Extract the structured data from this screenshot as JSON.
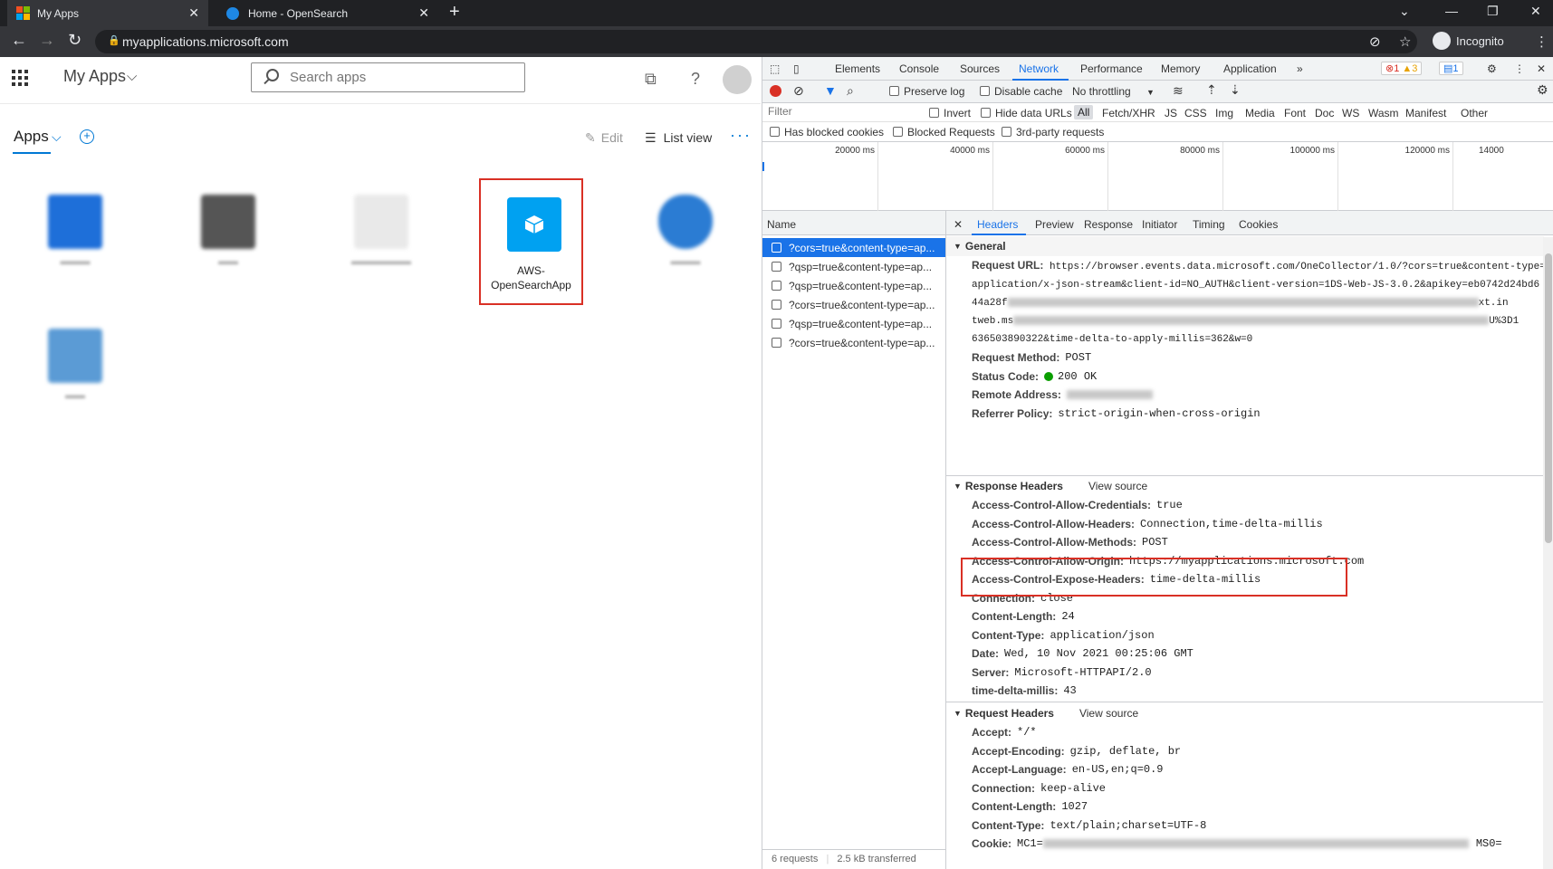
{
  "browser": {
    "tabs": [
      {
        "title": "My Apps",
        "active": true
      },
      {
        "title": "Home - OpenSearch",
        "active": false
      }
    ],
    "url": "myapplications.microsoft.com",
    "profile": "Incognito"
  },
  "myapps": {
    "app_title": "My Apps",
    "search_placeholder": "Search apps",
    "section_title": "Apps",
    "edit_label": "Edit",
    "list_view_label": "List view",
    "highlighted_app": {
      "line1": "AWS-",
      "line2": "OpenSearchApp"
    }
  },
  "devtools": {
    "tabs": [
      "Elements",
      "Console",
      "Sources",
      "Network",
      "Performance",
      "Memory",
      "Application"
    ],
    "active_tab": "Network",
    "error_count": "1",
    "warning_count": "3",
    "info_count": "1",
    "toolbar": {
      "preserve_log": "Preserve log",
      "disable_cache": "Disable cache",
      "throttling": "No throttling"
    },
    "filter": {
      "placeholder": "Filter",
      "invert": "Invert",
      "hide_data_urls": "Hide data URLs",
      "types": [
        "All",
        "Fetch/XHR",
        "JS",
        "CSS",
        "Img",
        "Media",
        "Font",
        "Doc",
        "WS",
        "Wasm",
        "Manifest",
        "Other"
      ],
      "has_blocked_cookies": "Has blocked cookies",
      "blocked_requests": "Blocked Requests",
      "third_party": "3rd-party requests"
    },
    "timeline_labels": [
      "20000 ms",
      "40000 ms",
      "60000 ms",
      "80000 ms",
      "100000 ms",
      "120000 ms",
      "14000"
    ],
    "request_list": {
      "column_name": "Name",
      "rows": [
        "?cors=true&content-type=ap...",
        "?qsp=true&content-type=ap...",
        "?qsp=true&content-type=ap...",
        "?cors=true&content-type=ap...",
        "?qsp=true&content-type=ap...",
        "?cors=true&content-type=ap..."
      ],
      "footer_requests": "6 requests",
      "footer_transferred": "2.5 kB transferred"
    },
    "detail_tabs": [
      "Headers",
      "Preview",
      "Response",
      "Initiator",
      "Timing",
      "Cookies"
    ],
    "general": {
      "title": "General",
      "request_url_label": "Request URL:",
      "request_url_1": "https://browser.events.data.microsoft.com/OneCollector/1.0/?cors=true&content-type=",
      "request_url_2": "application/x-json-stream&client-id=NO_AUTH&client-version=1DS-Web-JS-3.0.2&apikey=eb0742d24bd6",
      "request_url_3_start": "44a28f",
      "request_url_3_end": "xt.in",
      "request_url_4_start": "tweb.ms",
      "request_url_4_end": "U%3D1",
      "request_url_5": "636503890322&time-delta-to-apply-millis=362&w=0",
      "method_label": "Request Method:",
      "method": "POST",
      "status_label": "Status Code:",
      "status": "200 OK",
      "remote_label": "Remote Address:",
      "referrer_label": "Referrer Policy:",
      "referrer": "strict-origin-when-cross-origin"
    },
    "response_headers": {
      "title": "Response Headers",
      "view_source": "View source",
      "items": [
        {
          "k": "Access-Control-Allow-Credentials:",
          "v": "true"
        },
        {
          "k": "Access-Control-Allow-Headers:",
          "v": "Connection,time-delta-millis"
        },
        {
          "k": "Access-Control-Allow-Methods:",
          "v": "POST"
        },
        {
          "k": "Access-Control-Allow-Origin:",
          "v": "https://myapplications.microsoft.com"
        },
        {
          "k": "Access-Control-Expose-Headers:",
          "v": "time-delta-millis"
        },
        {
          "k": "Connection:",
          "v": "close"
        },
        {
          "k": "Content-Length:",
          "v": "24"
        },
        {
          "k": "Content-Type:",
          "v": "application/json"
        },
        {
          "k": "Date:",
          "v": "Wed, 10 Nov 2021 00:25:06 GMT"
        },
        {
          "k": "Server:",
          "v": "Microsoft-HTTPAPI/2.0"
        },
        {
          "k": "time-delta-millis:",
          "v": "43"
        }
      ]
    },
    "request_headers": {
      "title": "Request Headers",
      "view_source": "View source",
      "items": [
        {
          "k": "Accept:",
          "v": "*/*"
        },
        {
          "k": "Accept-Encoding:",
          "v": "gzip, deflate, br"
        },
        {
          "k": "Accept-Language:",
          "v": "en-US,en;q=0.9"
        },
        {
          "k": "Connection:",
          "v": "keep-alive"
        },
        {
          "k": "Content-Length:",
          "v": "1027"
        },
        {
          "k": "Content-Type:",
          "v": "text/plain;charset=UTF-8"
        },
        {
          "k": "Cookie:",
          "v": "MC1="
        }
      ],
      "cookie_tail": "MS0="
    }
  },
  "colors": {
    "accent": "#0078d4",
    "highlight": "#d93025",
    "aws_tile": "#00a1f1",
    "devtools_blue": "#1a73e8"
  }
}
